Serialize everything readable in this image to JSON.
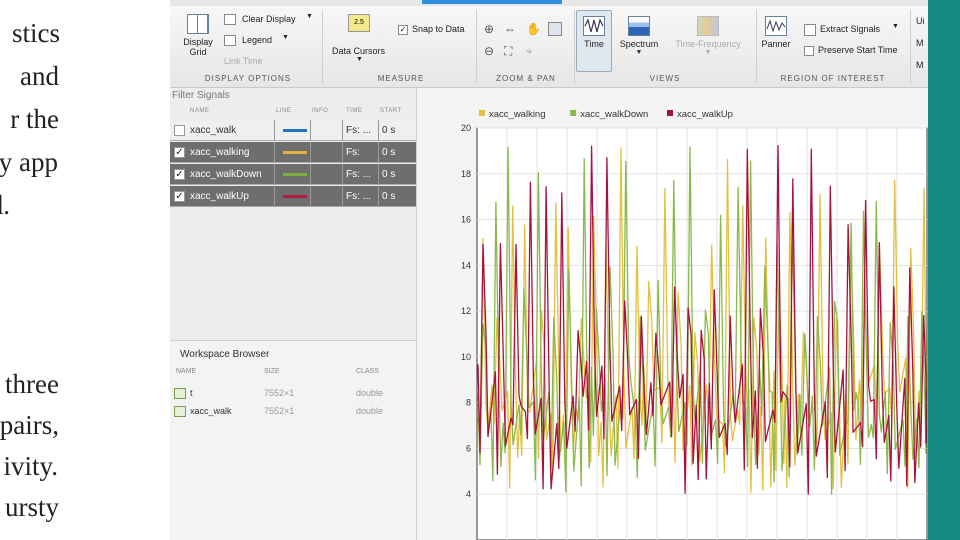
{
  "document": {
    "lines": [
      "stics",
      "and",
      "r the",
      "y app",
      "d.",
      "three",
      "pairs,",
      "ivity.",
      "ursty"
    ]
  },
  "toolstrip": {
    "display_options": {
      "label": "DISPLAY OPTIONS",
      "display_grid": "Display Grid",
      "clear_display": "Clear Display",
      "legend": "Legend",
      "link_time": "Link Time"
    },
    "measure": {
      "label": "MEASURE",
      "data_cursors": "Data Cursors",
      "snap_to_data": "Snap to Data",
      "cursor_badge": "2.5"
    },
    "zoom_pan": {
      "label": "ZOOM & PAN"
    },
    "views": {
      "label": "VIEWS",
      "time": "Time",
      "spectrum": "Spectrum",
      "time_frequency": "Time-Frequency"
    },
    "roi": {
      "label": "REGION OF INTEREST",
      "panner": "Panner",
      "extract_signals": "Extract Signals",
      "preserve_start_time": "Preserve Start Time"
    },
    "overflow": [
      "Ui",
      "M",
      "M"
    ]
  },
  "signals": {
    "filter_placeholder": "Filter Signals",
    "columns": [
      "NAME",
      "LINE",
      "INFO",
      "TIME",
      "START"
    ],
    "rows": [
      {
        "name": "xacc_walk",
        "checked": false,
        "color": "#1f77c4",
        "time": "Fs: ...",
        "start": "0 s"
      },
      {
        "name": "xacc_walking",
        "checked": true,
        "color": "#e6b23c",
        "time": "Fs:",
        "start": "0 s"
      },
      {
        "name": "xacc_walkDown",
        "checked": true,
        "color": "#7fb03f",
        "time": "Fs: ...",
        "start": "0 s"
      },
      {
        "name": "xacc_walkUp",
        "checked": true,
        "color": "#b0203c",
        "time": "Fs: ...",
        "start": "0 s"
      }
    ]
  },
  "workspace": {
    "title": "Workspace Browser",
    "columns": [
      "NAME",
      "SIZE",
      "CLASS"
    ],
    "rows": [
      {
        "name": "t",
        "size": "7552×1",
        "class": "double"
      },
      {
        "name": "xacc_walk",
        "size": "7552×1",
        "class": "double"
      }
    ]
  },
  "chart_data": {
    "type": "line",
    "ylim": [
      2,
      20
    ],
    "yticks": [
      4,
      6,
      8,
      10,
      12,
      14,
      16,
      18,
      20
    ],
    "grid": true,
    "legend_position": "top",
    "series": [
      {
        "name": "xacc_walking",
        "color": "#e3c040"
      },
      {
        "name": "xacc_walkDown",
        "color": "#8ab84a"
      },
      {
        "name": "xacc_walkUp",
        "color": "#a8123a"
      }
    ]
  }
}
